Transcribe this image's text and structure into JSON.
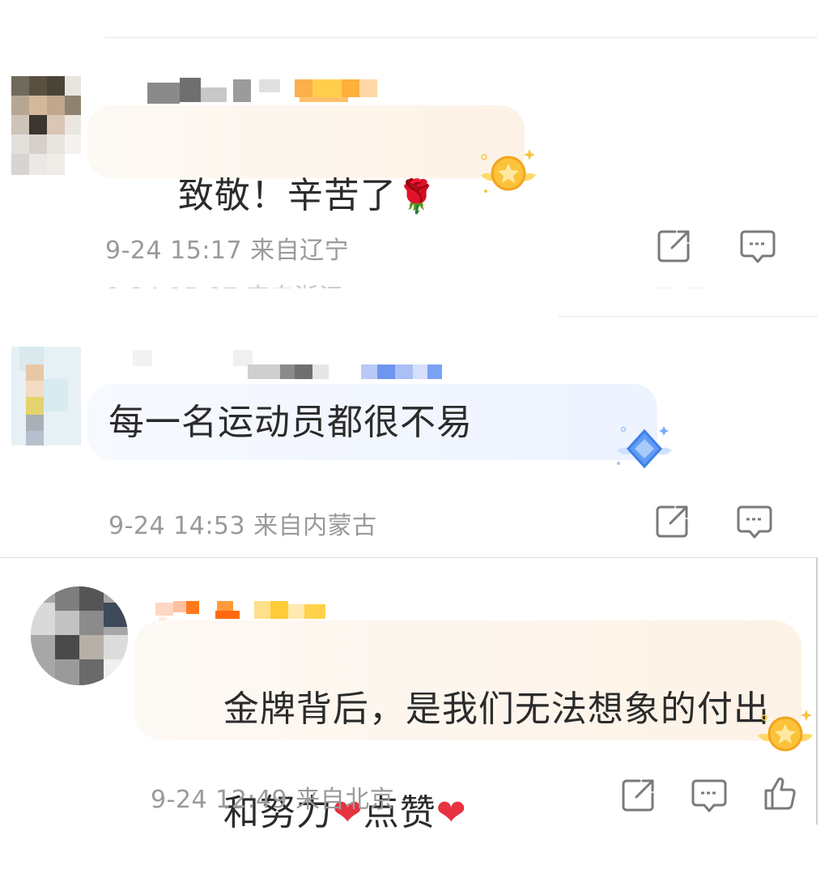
{
  "comments": [
    {
      "text": "致敬！辛苦了",
      "emoji": "🌹",
      "date": "9-24",
      "time": "15:17",
      "location": "来自辽宁",
      "badge": "gold-medal",
      "bubble_color": "#fdf2e6"
    },
    {
      "text": "每一名运动员都很不易",
      "date": "9-24",
      "time": "14:53",
      "location": "来自内蒙古",
      "badge": "blue-diamond",
      "bubble_color": "#edf3ff"
    },
    {
      "text_line1": "金牌背后，是我们无法想象的付出",
      "text_line2a": "和努力",
      "text_line2b": "点赞",
      "heart": "❤",
      "date": "9-24",
      "time": "12:49",
      "location": "来自北京",
      "badge": "gold-medal",
      "bubble_color": "#fdf2e6"
    }
  ],
  "icons": {
    "share": "share-icon",
    "reply": "comment-icon",
    "like": "thumbs-up-icon"
  },
  "colors": {
    "meta_text": "#9a9a9a",
    "heart": "#e8323f"
  }
}
